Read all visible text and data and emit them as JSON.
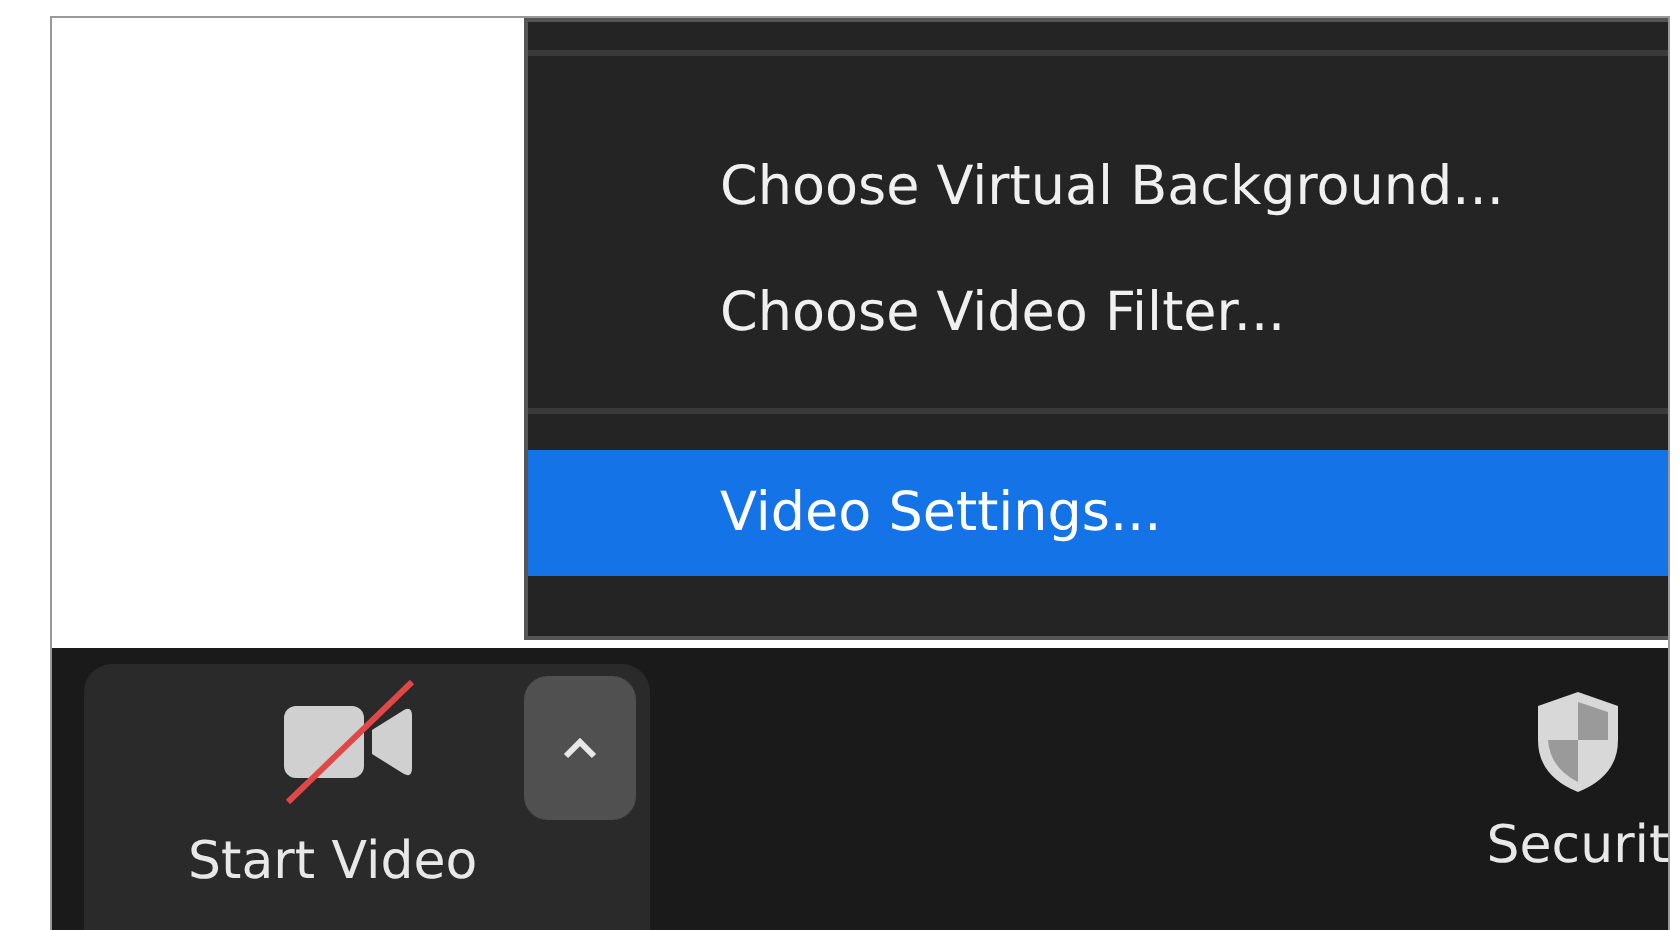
{
  "menu": {
    "items": [
      {
        "kind": "separator"
      },
      {
        "kind": "item",
        "label": "Choose Virtual Background...",
        "selected": false
      },
      {
        "kind": "item",
        "label": "Choose Video Filter...",
        "selected": false
      },
      {
        "kind": "separator"
      },
      {
        "kind": "item",
        "label": "Video Settings...",
        "selected": true
      }
    ]
  },
  "toolbar": {
    "buttons": [
      {
        "kind": "video",
        "label": "Start Video"
      },
      {
        "kind": "security",
        "label": "Securit"
      }
    ]
  }
}
